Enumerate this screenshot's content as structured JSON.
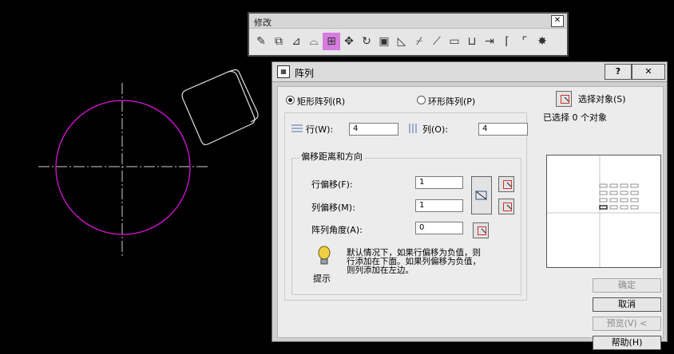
{
  "toolbar": {
    "title": "修改",
    "close_label": "✕",
    "tools": [
      {
        "name": "erase-icon",
        "glyph": "✎"
      },
      {
        "name": "copy-icon",
        "glyph": "⧉"
      },
      {
        "name": "mirror-icon",
        "glyph": "⊿"
      },
      {
        "name": "offset-icon",
        "glyph": "⌓"
      },
      {
        "name": "array-icon",
        "glyph": "⊞"
      },
      {
        "name": "move-icon",
        "glyph": "✥"
      },
      {
        "name": "rotate-icon",
        "glyph": "↻"
      },
      {
        "name": "scale-icon",
        "glyph": "▣"
      },
      {
        "name": "stretch-icon",
        "glyph": "◺"
      },
      {
        "name": "trim-icon",
        "glyph": "⌿"
      },
      {
        "name": "extend-icon",
        "glyph": "⟋"
      },
      {
        "name": "break-at-point-icon",
        "glyph": "▭"
      },
      {
        "name": "break-icon",
        "glyph": "⊔"
      },
      {
        "name": "join-icon",
        "glyph": "⇥"
      },
      {
        "name": "chamfer-icon",
        "glyph": "⌈"
      },
      {
        "name": "fillet-icon",
        "glyph": "⌜"
      },
      {
        "name": "explode-icon",
        "glyph": "✸"
      }
    ],
    "active_tool": "array-icon"
  },
  "dialog": {
    "title": "阵列",
    "help_label": "?",
    "close_label": "✕",
    "rect_radio_label": "矩形阵列(R)",
    "polar_radio_label": "环形阵列(P)",
    "rect_selected": true,
    "select_objects_label": "选择对象(S)",
    "selected_count_text": "已选择 0 个对象",
    "rows_label": "行(W):",
    "rows_value": "4",
    "cols_label": "列(O):",
    "cols_value": "4",
    "offset_group_title": "偏移距离和方向",
    "row_offset_label": "行偏移(F):",
    "row_offset_value": "1",
    "col_offset_label": "列偏移(M):",
    "col_offset_value": "1",
    "angle_label": "阵列角度(A):",
    "angle_value": "0",
    "tip_text_line1": "默认情况下，如果行偏移为负值，则",
    "tip_text_line2": "行添加在下面。如果列偏移为负值，",
    "tip_text_line3": "则列添加在左边。",
    "tip_label": "提示",
    "buttons": {
      "ok": "确定",
      "cancel": "取消",
      "preview": "预览(V) <",
      "help": "帮助(H)"
    }
  }
}
